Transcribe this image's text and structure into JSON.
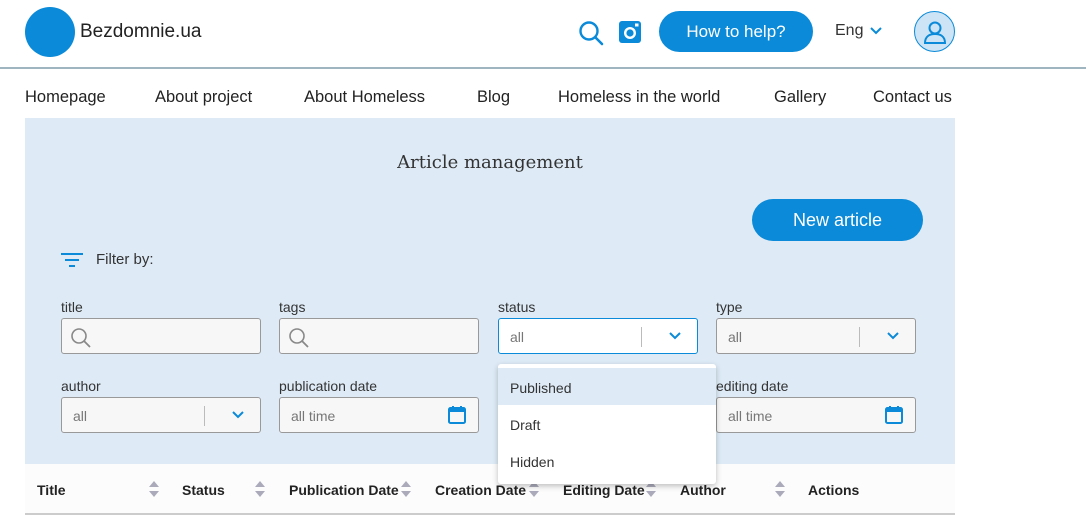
{
  "header": {
    "logo_text": "Bezdomnie.ua",
    "help_button": "How to help?",
    "language": "Eng",
    "icons": [
      "search-icon",
      "instagram-icon",
      "chevron-down-icon",
      "user-icon"
    ],
    "brand_color": "#0a8ad8"
  },
  "nav": {
    "items": [
      "Homepage",
      "About project",
      "About Homeless",
      "Blog",
      "Homeless in the world",
      "Gallery",
      "Contact us"
    ]
  },
  "panel": {
    "title": "Article management",
    "new_article": "New article",
    "filter_by": "Filter by:"
  },
  "filters": {
    "title": {
      "label": "title",
      "value": ""
    },
    "tags": {
      "label": "tags",
      "value": ""
    },
    "status": {
      "label": "status",
      "value": "all"
    },
    "type": {
      "label": "type",
      "value": "all"
    },
    "author": {
      "label": "author",
      "value": "all"
    },
    "publication_date": {
      "label": "publication date",
      "value": "all time"
    },
    "editing_date": {
      "label": "editing date",
      "value": "all time"
    }
  },
  "status_dropdown": {
    "options": [
      "Published",
      "Draft",
      "Hidden"
    ],
    "highlighted": "Published"
  },
  "table": {
    "columns": [
      "Title",
      "Status",
      "Publication Date",
      "Creation Date",
      "Editing Date",
      "Author",
      "Actions"
    ]
  }
}
